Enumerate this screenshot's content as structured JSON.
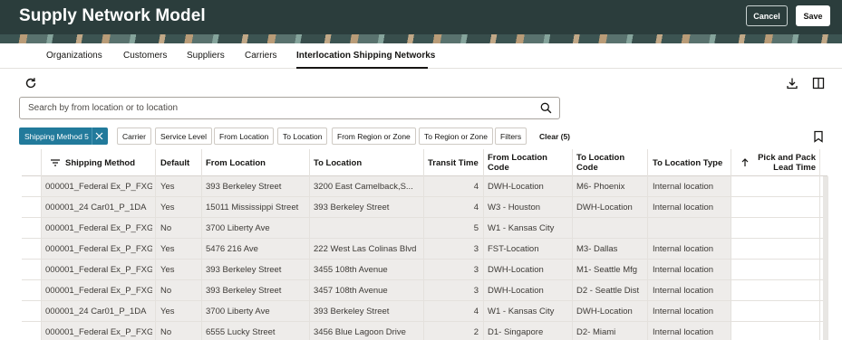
{
  "header": {
    "title": "Supply Network Model",
    "cancel_label": "Cancel",
    "save_label": "Save"
  },
  "tabs": [
    {
      "label": "Organizations"
    },
    {
      "label": "Customers"
    },
    {
      "label": "Suppliers"
    },
    {
      "label": "Carriers"
    },
    {
      "label": "Interlocation Shipping Networks",
      "active": true
    }
  ],
  "toolbar": {
    "refresh_icon": "refresh-icon",
    "download_icon": "download-icon",
    "panel_icon": "split-panel-icon",
    "bookmark_icon": "bookmark-icon"
  },
  "search": {
    "placeholder": "Search by from location or to location",
    "value": ""
  },
  "filters": {
    "active_chip": "Shipping Method 5",
    "chips": [
      "Carrier",
      "Service Level",
      "From Location",
      "To Location",
      "From Region or Zone",
      "To Region or Zone",
      "Filters"
    ],
    "clear_label": "Clear (5)"
  },
  "table": {
    "sort_icon": "sort-lines-icon",
    "headers": {
      "shipping_method": "Shipping Method",
      "default": "Default",
      "from_location": "From Location",
      "to_location": "To Location",
      "transit_time": "Transit Time",
      "from_location_code": "From Location Code",
      "to_location_code": "To Location Code",
      "to_location_type": "To Location Type",
      "pick_pack_lead_time": "Pick and Pack Lead Time"
    },
    "rows": [
      {
        "shipping_method": "000001_Federal Ex_P_FXG",
        "default": "Yes",
        "from_location": "393 Berkeley Street",
        "to_location": "3200 East Camelback,S...",
        "transit_time": "4",
        "from_code": "DWH-Location",
        "to_code": "M6- Phoenix",
        "to_type": "Internal location"
      },
      {
        "shipping_method": "000001_24 Car01_P_1DA",
        "default": "Yes",
        "from_location": "15011 Mississippi Street",
        "to_location": "393 Berkeley Street",
        "transit_time": "4",
        "from_code": "W3 - Houston",
        "to_code": "DWH-Location",
        "to_type": "Internal location"
      },
      {
        "shipping_method": "000001_Federal Ex_P_FXG",
        "default": "No",
        "from_location": "3700 Liberty Ave",
        "to_location": "",
        "transit_time": "5",
        "from_code": "W1 - Kansas City",
        "to_code": "",
        "to_type": ""
      },
      {
        "shipping_method": "000001_Federal Ex_P_FXG",
        "default": "Yes",
        "from_location": "5476 216 Ave",
        "to_location": "222 West Las Colinas Blvd",
        "transit_time": "3",
        "from_code": "FST-Location",
        "to_code": "M3- Dallas",
        "to_type": "Internal location"
      },
      {
        "shipping_method": "000001_Federal Ex_P_FXG",
        "default": "Yes",
        "from_location": "393 Berkeley Street",
        "to_location": "3455 108th Avenue",
        "transit_time": "3",
        "from_code": "DWH-Location",
        "to_code": "M1- Seattle Mfg",
        "to_type": "Internal location"
      },
      {
        "shipping_method": "000001_Federal Ex_P_FXG",
        "default": "No",
        "from_location": "393 Berkeley Street",
        "to_location": "3457 108th Avenue",
        "transit_time": "3",
        "from_code": "DWH-Location",
        "to_code": "D2 - Seattle Dist",
        "to_type": "Internal location"
      },
      {
        "shipping_method": "000001_24 Car01_P_1DA",
        "default": "Yes",
        "from_location": "3700 Liberty Ave",
        "to_location": "393 Berkeley Street",
        "transit_time": "4",
        "from_code": "W1 - Kansas City",
        "to_code": "DWH-Location",
        "to_type": "Internal location"
      },
      {
        "shipping_method": "000001_Federal Ex_P_FXG",
        "default": "No",
        "from_location": "6555 Lucky Street",
        "to_location": "3456 Blue Lagoon Drive",
        "transit_time": "2",
        "from_code": "D1- Singapore",
        "to_code": "D2- Miami",
        "to_type": "Internal location"
      }
    ]
  }
}
